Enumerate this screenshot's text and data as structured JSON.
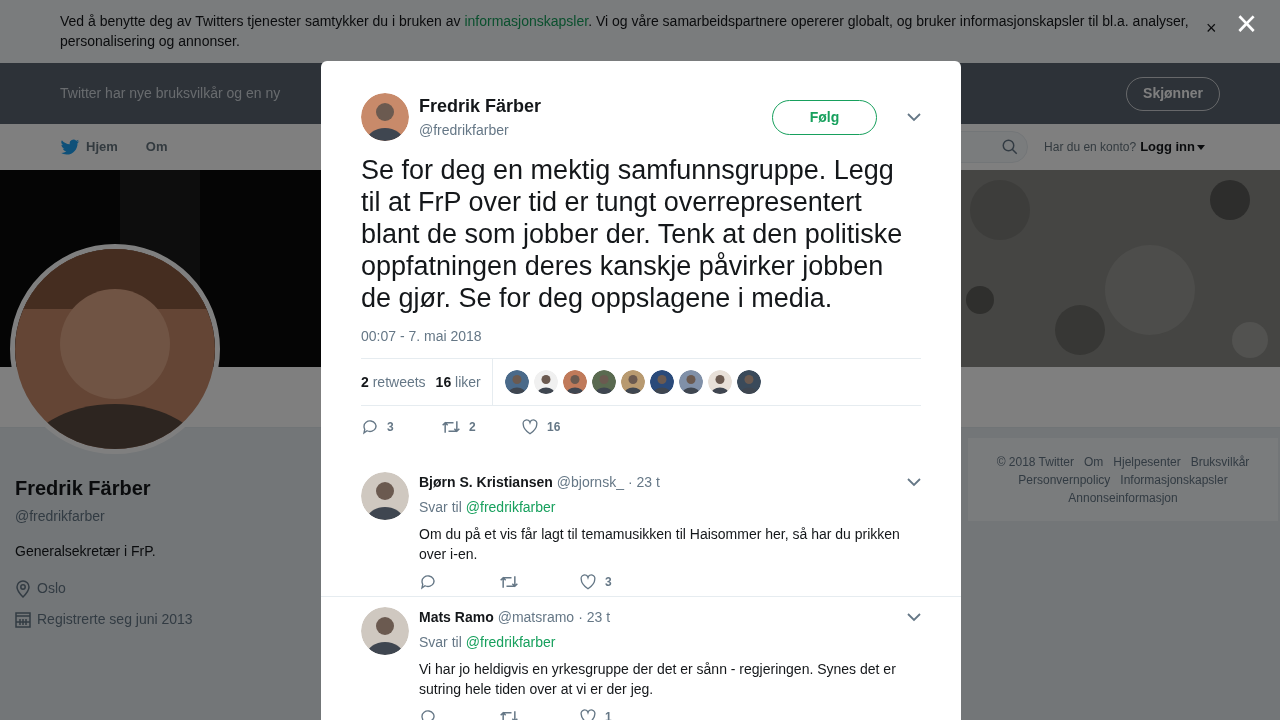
{
  "cookie_banner": {
    "text_before": "Ved å benytte deg av Twitters tjenester samtykker du i bruken av ",
    "link": "informasjonskapsler",
    "text_after": ". Vi og våre samarbeidspartnere opererer globalt, og bruker informasjonskapsler til bl.a. analyser, personalisering og annonser.",
    "close": "×"
  },
  "notice_bar": {
    "text": "Twitter har nye bruksvilkår og en ny",
    "button": "Skjønner"
  },
  "nav": {
    "items": [
      {
        "label": "Hjem",
        "kind": "home"
      },
      {
        "label": "Om",
        "kind": "page"
      }
    ],
    "account_prompt": "Har du en konto?",
    "login": "Logg inn"
  },
  "profile": {
    "name": "Fredrik Färber",
    "handle": "@fredrikfarber",
    "bio": "Generalsekretær i FrP.",
    "location": "Oslo",
    "joined": "Registrerte seg juni 2013"
  },
  "footer_links": [
    "© 2018 Twitter",
    "Om",
    "Hjelpesenter",
    "Bruksvilkår",
    "Personvernpolicy",
    "Informasjonskapsler",
    "Annonseinformasjon"
  ],
  "modal": {
    "author": {
      "name": "Fredrik Färber",
      "handle": "@fredrikfarber"
    },
    "follow_button": "Følg",
    "text": "Se for deg en mektig samfunnsgruppe. Legg til at FrP over tid er tungt overrepresentert blant de som jobber der. Tenk at den politiske oppfatningen deres kanskje påvirker jobben de gjør. Se for deg oppslagene i media.",
    "timestamp": "00:07 - 7. mai 2018",
    "stats": [
      {
        "count": "2",
        "label": "retweets"
      },
      {
        "count": "16",
        "label": "liker"
      }
    ],
    "liker_avatars": [
      {
        "color": "#4a6a8a"
      },
      {
        "color": "#f0f0f0"
      },
      {
        "color": "#c07a5a"
      },
      {
        "color": "#5a6a50"
      },
      {
        "color": "#b89a70"
      },
      {
        "color": "#2a4a7a"
      },
      {
        "color": "#8090a8"
      },
      {
        "color": "#e8e0d8"
      },
      {
        "color": "#3a4a5a"
      }
    ],
    "actions": {
      "replies": "3",
      "retweets": "2",
      "likes": "16"
    },
    "replies": [
      {
        "name": "Bjørn S. Kristiansen",
        "handle": "@bjornsk_",
        "time": "· 23 t",
        "reply_to_label": "Svar til",
        "reply_to": "@fredrikfarber",
        "text": "Om du på et vis får lagt til temamusikken til Haisommer her, så har du prikken over i-en.",
        "likes": "3"
      },
      {
        "name": "Mats Ramo",
        "handle": "@matsramo",
        "time": "· 23 t",
        "reply_to_label": "Svar til",
        "reply_to": "@fredrikfarber",
        "text": "Vi har jo heldigvis en yrkesgruppe der det er sånn - regjeringen. Synes det er sutring hele tiden over at vi er der jeg.",
        "likes": "1"
      }
    ]
  },
  "close_button": "×"
}
